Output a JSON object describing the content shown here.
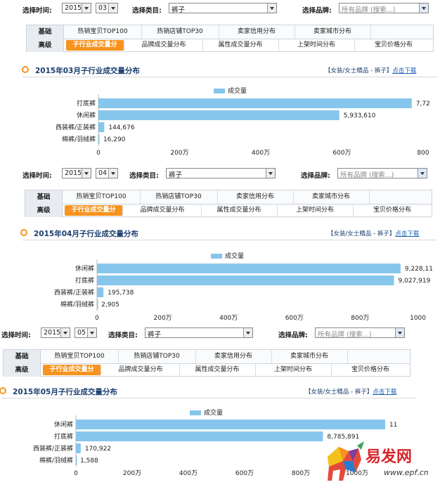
{
  "labels": {
    "time_label": "选择时间:",
    "category_label": "选择类目:",
    "category_value": "裤子",
    "brand_label": "选择品牌:",
    "brand_placeholder": "所有品牌 (搜索...)",
    "tab_row1_head": "基础",
    "tab_row2_head": "高级",
    "tabs_row1": [
      "热销宝贝TOP100",
      "热销店铺TOP30",
      "卖家信用分布",
      "卖家城市分布"
    ],
    "tabs_row2": [
      "子行业成交量分",
      "品牌成交量分布",
      "属性成交量分布",
      "上架时间分布",
      "宝贝价格分布"
    ],
    "breadcrumb_cat": "【女装/女士精品 - 裤子】",
    "breadcrumb_link": "点击下载",
    "legend": "成交量",
    "watermark_brand": "易发网",
    "watermark_url": "www.epf.cn"
  },
  "panels": [
    {
      "year": "2015",
      "month": "03",
      "title": "2015年03月子行业成交量分布"
    },
    {
      "year": "2015",
      "month": "04",
      "title": "2015年04月子行业成交量分布"
    },
    {
      "year": "2015",
      "month": "05",
      "title": "2015年05月子行业成交量分布"
    }
  ],
  "chart_data": [
    {
      "type": "bar",
      "orientation": "horizontal",
      "title": "2015年03月子行业成交量分布",
      "categories": [
        "打底裤",
        "休闲裤",
        "西装裤/正装裤",
        "棉裤/羽绒裤"
      ],
      "series": [
        {
          "name": "成交量",
          "values": [
            7720000,
            5933610,
            144676,
            16290
          ]
        }
      ],
      "value_labels": [
        "7,72",
        "5,933,610",
        "144,676",
        "16,290"
      ],
      "xlim": [
        0,
        8000000
      ],
      "ticks": [
        0,
        2000000,
        4000000,
        6000000,
        8000000
      ],
      "tick_labels": [
        "0",
        "200万",
        "400万",
        "600万",
        "800"
      ],
      "legend": "top-center"
    },
    {
      "type": "bar",
      "orientation": "horizontal",
      "title": "2015年04月子行业成交量分布",
      "categories": [
        "休闲裤",
        "打底裤",
        "西装裤/正装裤",
        "棉裤/羽绒裤"
      ],
      "series": [
        {
          "name": "成交量",
          "values": [
            9228110,
            9027919,
            195738,
            2905
          ]
        }
      ],
      "value_labels": [
        "9,228,11",
        "9,027,919",
        "195,738",
        "2,905"
      ],
      "xlim": [
        0,
        10000000
      ],
      "ticks": [
        0,
        2000000,
        4000000,
        6000000,
        8000000,
        10000000
      ],
      "tick_labels": [
        "0",
        "200万",
        "400万",
        "600万",
        "800万",
        "1000"
      ],
      "legend": "top-center"
    },
    {
      "type": "bar",
      "orientation": "horizontal",
      "title": "2015年05月子行业成交量分布",
      "categories": [
        "休闲裤",
        "打底裤",
        "西装裤/正装裤",
        "棉裤/羽绒裤"
      ],
      "series": [
        {
          "name": "成交量",
          "values": [
            11000000,
            8785891,
            170922,
            1588
          ]
        }
      ],
      "value_labels": [
        "11",
        "8,785,891",
        "170,922",
        "1,588"
      ],
      "xlim": [
        0,
        12000000
      ],
      "ticks": [
        0,
        2000000,
        4000000,
        6000000,
        8000000,
        10000000
      ],
      "tick_labels": [
        "0",
        "200万",
        "400万",
        "600万",
        "800万",
        "1000万"
      ],
      "legend": "top-center"
    }
  ],
  "colors": {
    "bar": "#87c6ec",
    "accent": "#f7931e",
    "title": "#1a3e6e"
  }
}
